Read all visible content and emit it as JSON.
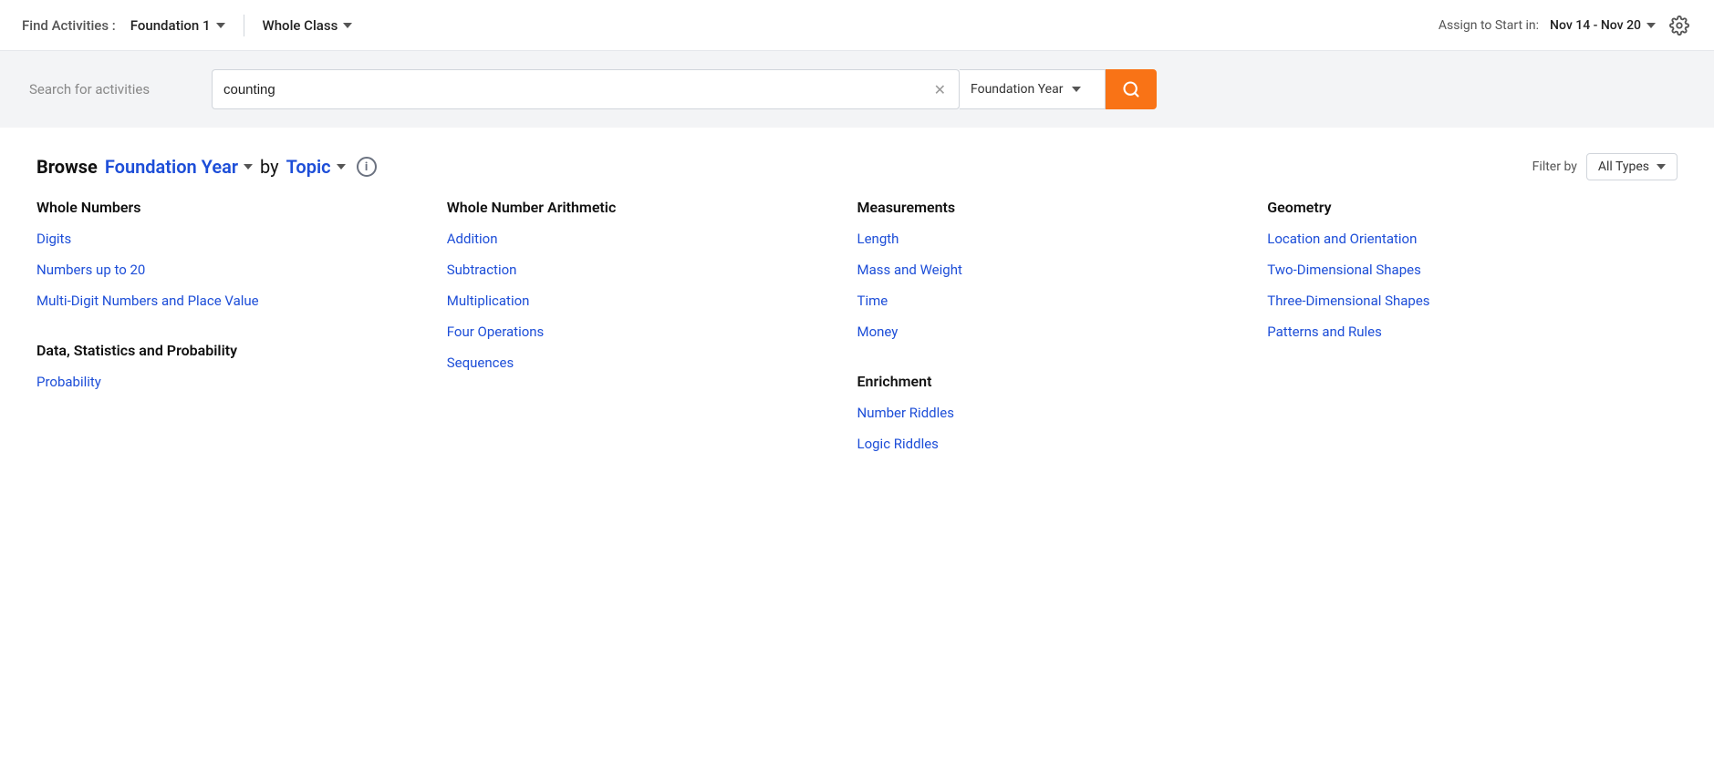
{
  "header": {
    "find_label": "Find Activities :",
    "foundation_dropdown": "Foundation 1",
    "class_dropdown": "Whole Class",
    "assign_label": "Assign to Start in:",
    "date_range": "Nov 14 - Nov 20"
  },
  "search": {
    "placeholder": "Search for activities",
    "input_value": "counting",
    "year_filter": "Foundation Year",
    "search_icon": "🔍"
  },
  "browse": {
    "title": "Browse",
    "year": "Foundation Year",
    "by": "by",
    "topic": "Topic",
    "filter_label": "Filter by",
    "filter_value": "All Types"
  },
  "topics": {
    "columns": [
      {
        "sections": [
          {
            "title": "Whole Numbers",
            "links": [
              "Digits",
              "Numbers up to 20",
              "Multi-Digit Numbers and Place Value"
            ]
          },
          {
            "title": "Data, Statistics and Probability",
            "links": [
              "Probability"
            ]
          }
        ]
      },
      {
        "sections": [
          {
            "title": "Whole Number Arithmetic",
            "links": [
              "Addition",
              "Subtraction",
              "Multiplication",
              "Four Operations",
              "Sequences"
            ]
          }
        ]
      },
      {
        "sections": [
          {
            "title": "Measurements",
            "links": [
              "Length",
              "Mass and Weight",
              "Time",
              "Money"
            ]
          },
          {
            "title": "Enrichment",
            "links": [
              "Number Riddles",
              "Logic Riddles"
            ]
          }
        ]
      },
      {
        "sections": [
          {
            "title": "Geometry",
            "links": [
              "Location and Orientation",
              "Two-Dimensional Shapes",
              "Three-Dimensional Shapes",
              "Patterns and Rules"
            ]
          }
        ]
      }
    ]
  }
}
